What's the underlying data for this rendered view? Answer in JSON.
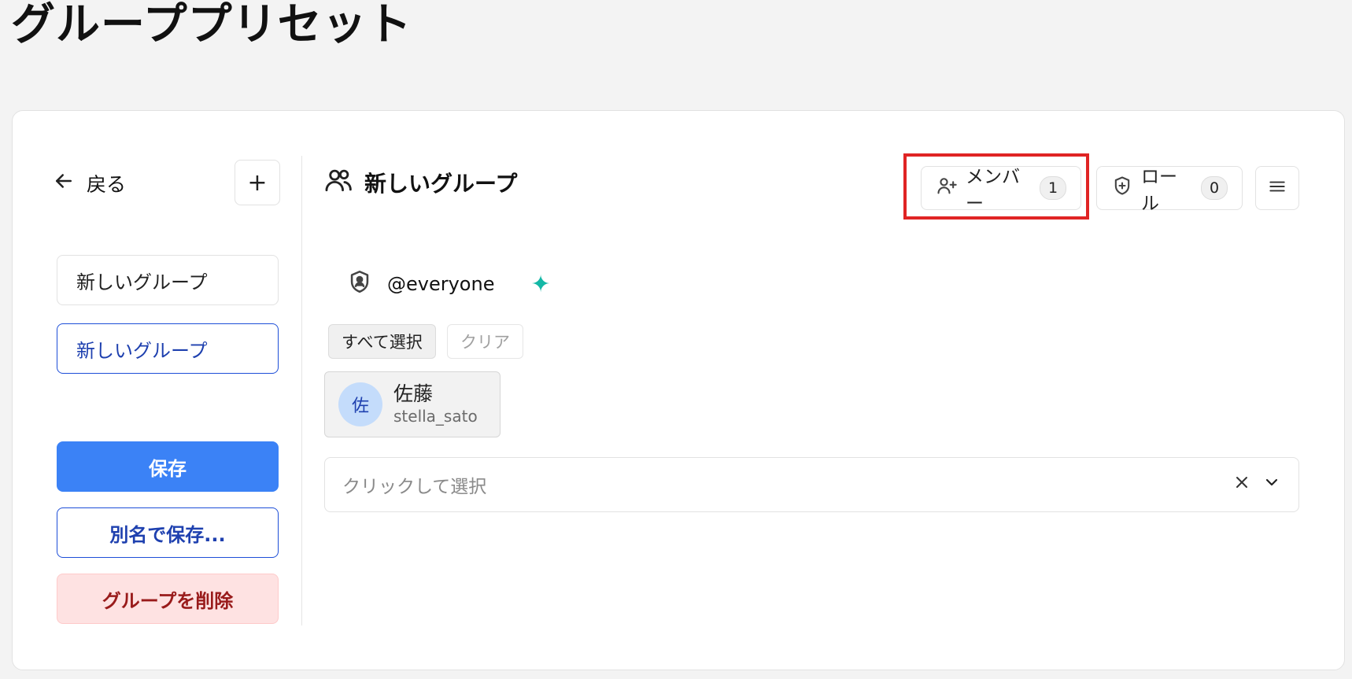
{
  "page": {
    "title": "グループプリセット"
  },
  "sidebar": {
    "back_label": "戻る",
    "add_label": "+",
    "presets": [
      {
        "label": "新しいグループ",
        "selected": false
      },
      {
        "label": "新しいグループ",
        "selected": true
      }
    ],
    "save_label": "保存",
    "save_as_label": "別名で保存...",
    "delete_label": "グループを削除"
  },
  "main": {
    "group_title": "新しいグループ",
    "tabs": {
      "members": {
        "label": "メンバー",
        "count": "1",
        "highlighted": true
      },
      "roles": {
        "label": "ロール",
        "count": "0"
      }
    },
    "role": {
      "name": "@everyone",
      "sparkle": "✦",
      "sparkle_color": "#14b8a6"
    },
    "select_all_label": "すべて選択",
    "clear_label": "クリア",
    "members": [
      {
        "avatar": "佐",
        "name": "佐藤",
        "handle": "stella_sato"
      }
    ],
    "select_placeholder": "クリックして選択"
  },
  "colors": {
    "primary": "#3b82f6",
    "highlight": "#e02424",
    "danger_bg": "#fee2e2",
    "danger_text": "#991b1b"
  }
}
